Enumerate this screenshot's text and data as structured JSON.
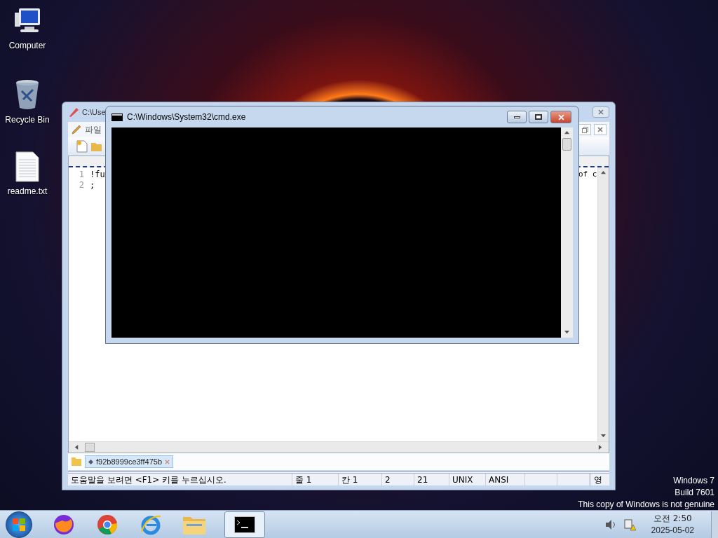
{
  "desktop": {
    "icons": [
      {
        "kind": "computer",
        "label": "Computer"
      },
      {
        "kind": "recycle",
        "label": "Recycle Bin"
      },
      {
        "kind": "file",
        "label": "readme.txt"
      }
    ]
  },
  "editor_window": {
    "title": "C:\\Use",
    "menu": [
      "파일"
    ],
    "lines": [
      {
        "number": "1",
        "text": "!fu"
      },
      {
        "number": "2",
        "text": ";"
      }
    ],
    "right_fragment": "of c",
    "tab": {
      "label": "f92b8999ce3ff475b"
    },
    "status_bar": [
      "도움말을 보려면 <F1> 키를 누르십시오.",
      "줄 1",
      "칸 1",
      "2",
      "21",
      "UNIX",
      "ANSI",
      "영"
    ]
  },
  "cmd_window": {
    "title": "C:\\Windows\\System32\\cmd.exe"
  },
  "notice": [
    "Windows 7",
    "Build 7601",
    "This copy of Windows is not genuine"
  ],
  "taskbar": {
    "apps": [
      {
        "kind": "firefox",
        "selected": false
      },
      {
        "kind": "chrome",
        "selected": false
      },
      {
        "kind": "ie",
        "selected": false
      },
      {
        "kind": "explorer",
        "selected": false
      },
      {
        "kind": "cmd",
        "selected": true
      }
    ],
    "clock": {
      "time": "오전 2:50",
      "date": "2025-05-02"
    }
  }
}
